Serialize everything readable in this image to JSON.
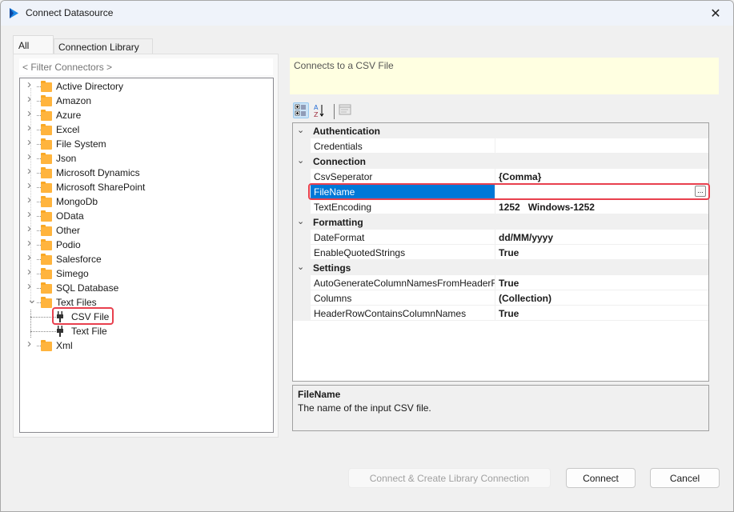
{
  "window": {
    "title": "Connect Datasource",
    "app_icon": "play-logo-icon",
    "close_icon": "close-icon"
  },
  "tabs": [
    {
      "label": "All",
      "active": true
    },
    {
      "label": "Connection Library",
      "active": false
    }
  ],
  "filter": {
    "placeholder": "< Filter Connectors >",
    "value": ""
  },
  "tree": {
    "items": [
      {
        "label": "Active Directory",
        "type": "folder",
        "expanded": false
      },
      {
        "label": "Amazon",
        "type": "folder",
        "expanded": false
      },
      {
        "label": "Azure",
        "type": "folder",
        "expanded": false
      },
      {
        "label": "Excel",
        "type": "folder",
        "expanded": false
      },
      {
        "label": "File System",
        "type": "folder",
        "expanded": false
      },
      {
        "label": "Json",
        "type": "folder",
        "expanded": false
      },
      {
        "label": "Microsoft Dynamics",
        "type": "folder",
        "expanded": false
      },
      {
        "label": "Microsoft SharePoint",
        "type": "folder",
        "expanded": false
      },
      {
        "label": "MongoDb",
        "type": "folder",
        "expanded": false
      },
      {
        "label": "OData",
        "type": "folder",
        "expanded": false
      },
      {
        "label": "Other",
        "type": "folder",
        "expanded": false
      },
      {
        "label": "Podio",
        "type": "folder",
        "expanded": false
      },
      {
        "label": "Salesforce",
        "type": "folder",
        "expanded": false
      },
      {
        "label": "Simego",
        "type": "folder",
        "expanded": false
      },
      {
        "label": "SQL Database",
        "type": "folder",
        "expanded": false
      },
      {
        "label": "Text Files",
        "type": "folder",
        "expanded": true
      },
      {
        "label": "CSV File",
        "type": "connector",
        "selected": true
      },
      {
        "label": "Text File",
        "type": "connector",
        "selected": false
      },
      {
        "label": "Xml",
        "type": "folder",
        "expanded": false
      }
    ]
  },
  "description": "Connects to a CSV File",
  "property_toolbar": {
    "categorized_icon": "categorized-icon",
    "alphabetical_icon": "sort-az-icon",
    "property_pages_icon": "property-pages-icon"
  },
  "property_grid": {
    "categories": [
      {
        "name": "Authentication",
        "properties": [
          {
            "name": "Credentials",
            "value": ""
          }
        ]
      },
      {
        "name": "Connection",
        "properties": [
          {
            "name": "CsvSeperator",
            "value": "{Comma}"
          },
          {
            "name": "FileName",
            "value": "",
            "selected": true,
            "ellipsis": "..."
          },
          {
            "name": "TextEncoding",
            "value": "1252   Windows-1252"
          }
        ]
      },
      {
        "name": "Formatting",
        "properties": [
          {
            "name": "DateFormat",
            "value": "dd/MM/yyyy"
          },
          {
            "name": "EnableQuotedStrings",
            "value": "True"
          }
        ]
      },
      {
        "name": "Settings",
        "properties": [
          {
            "name": "AutoGenerateColumnNamesFromHeaderR",
            "value": "True"
          },
          {
            "name": "Columns",
            "value": "(Collection)"
          },
          {
            "name": "HeaderRowContainsColumnNames",
            "value": "True"
          }
        ]
      }
    ]
  },
  "help": {
    "title": "FileName",
    "text": "The name of the input CSV file."
  },
  "buttons": {
    "connect_create": "Connect & Create Library Connection",
    "connect": "Connect",
    "cancel": "Cancel"
  },
  "colors": {
    "accent": "#0078d7",
    "highlight": "#e8404e",
    "folder": "#ffb43d",
    "description_bg": "#ffffe1"
  }
}
